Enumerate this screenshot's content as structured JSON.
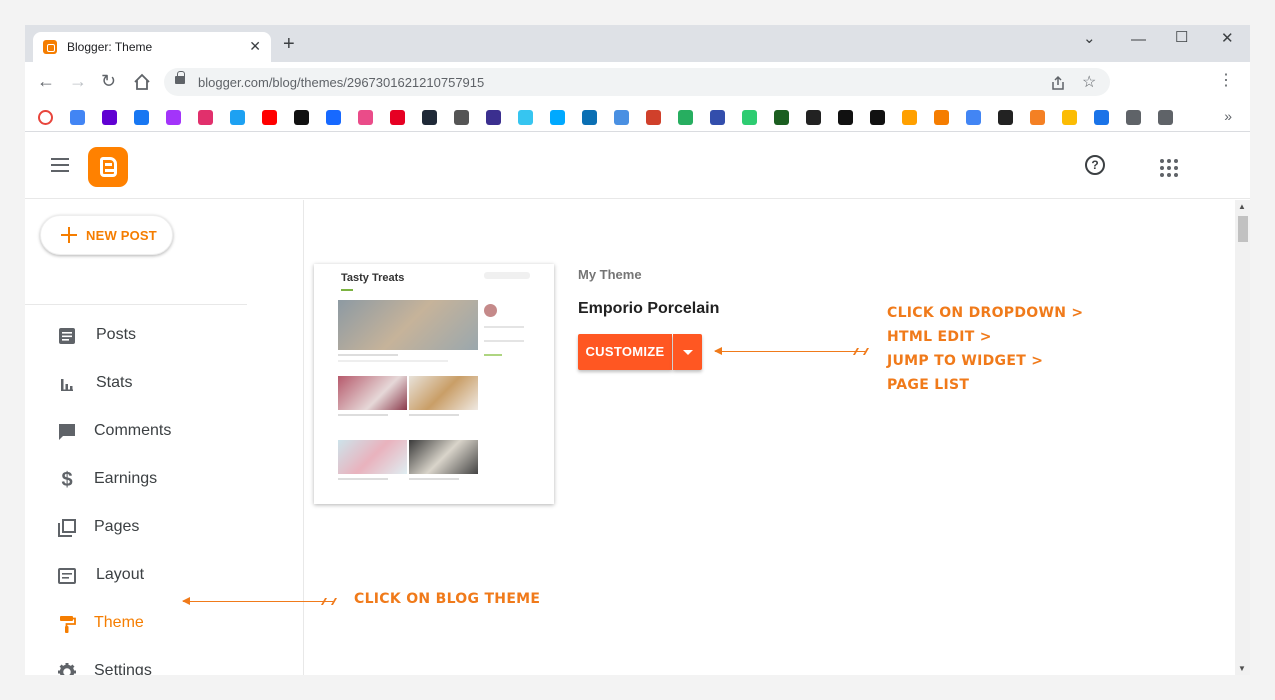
{
  "browser": {
    "tab_title": "Blogger: Theme",
    "tab_close": "✕",
    "new_tab": "+",
    "url": "blogger.com/blog/themes/2967301621210757915",
    "controls": {
      "chevron": "⌄",
      "minimize": "—",
      "maximize": "☐",
      "close": "✕"
    },
    "more_bookmarks": "»",
    "menu": "⋮",
    "bookmark_colors": [
      "#e8453c",
      "#4285f4",
      "#6001d2",
      "#1877f2",
      "#a334fa",
      "#e1306c",
      "#1da1f2",
      "#ff0000",
      "#111111",
      "#1769ff",
      "#ea4c89",
      "#e60023",
      "#1f2937",
      "#555555",
      "#3b2f8f",
      "#36c5f0",
      "#00a9ff",
      "#0b6fb3",
      "#4a90e2",
      "#d0402b",
      "#27ae60",
      "#334eac",
      "#2ecc71",
      "#1b5e20",
      "#222222",
      "#111111",
      "#111111",
      "#ffa000",
      "#f57d00",
      "#4285f4",
      "#222222",
      "#f48024",
      "#fbbc04",
      "#1a73e8",
      "#5f6368",
      "#5f6368"
    ]
  },
  "header": {
    "help_label": "?",
    "logo": "blogger-logo"
  },
  "sidebar": {
    "new_post_label": "NEW POST",
    "items": [
      {
        "label": "Posts",
        "icon": "posts-icon"
      },
      {
        "label": "Stats",
        "icon": "stats-icon"
      },
      {
        "label": "Comments",
        "icon": "comments-icon"
      },
      {
        "label": "Earnings",
        "icon": "dollar-icon"
      },
      {
        "label": "Pages",
        "icon": "pages-icon"
      },
      {
        "label": "Layout",
        "icon": "layout-icon"
      },
      {
        "label": "Theme",
        "icon": "paint-roller-icon",
        "active": true
      },
      {
        "label": "Settings",
        "icon": "gear-icon"
      }
    ],
    "accent": "#f57d00"
  },
  "main": {
    "preview_title": "Tasty Treats",
    "theme_label": "My Theme",
    "theme_name": "Emporio Porcelain",
    "customize_label": "CUSTOMIZE",
    "button_color": "#ff5722"
  },
  "annotations": {
    "dropdown_steps": [
      "CLICK ON DROPDOWN >",
      "HTML EDIT >",
      "JUMP TO WIDGET >",
      "PAGE LIST"
    ],
    "theme_note": "CLICK ON BLOG THEME",
    "color": "#f07a1a"
  }
}
